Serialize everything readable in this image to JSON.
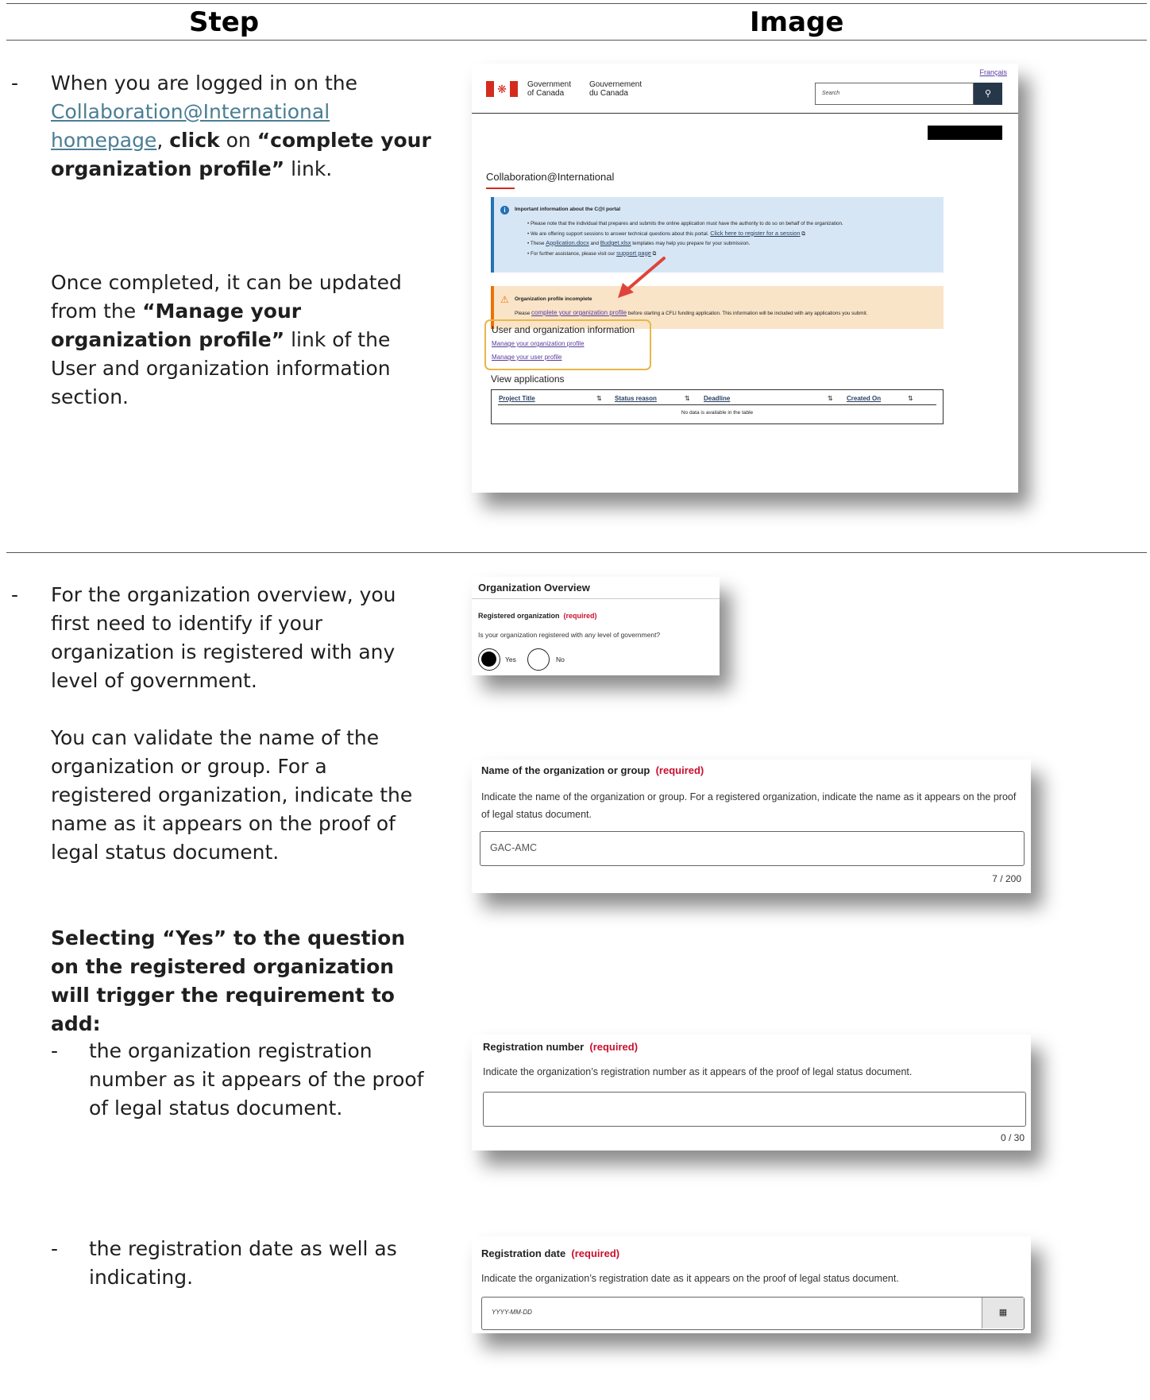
{
  "header": {
    "step": "Step",
    "image": "Image"
  },
  "section1": {
    "p1_a": "When you are logged in on the ",
    "p1_link": "Collaboration@International homepage",
    "p1_b": ", ",
    "p1_click": "click",
    "p1_c": " on ",
    "p1_bold": "“complete your organization profile”",
    "p1_d": " link.",
    "p2_a": "Once completed, it can be updated from the ",
    "p2_bold": "“Manage your organization profile”",
    "p2_b": " link of the User and organization information section."
  },
  "portal": {
    "lang_link": "Français",
    "gov_en_1": "Government",
    "gov_en_2": "of Canada",
    "gov_fr_1": "Gouvernement",
    "gov_fr_2": "du Canada",
    "search_placeholder": "Search",
    "site_title": "Collaboration@International",
    "info_title": "Important information about the C@I portal",
    "info_b1": "Please note that the individual that prepares and submits the online application must have the authority to do so on behalf of the organization.",
    "info_b2_a": "We are offering support sessions to answer technical questions about this portal. ",
    "info_b2_link": "Click here to register for a session",
    "info_b3_a": "These ",
    "info_b3_link1": "Application.docx",
    "info_b3_b": " and ",
    "info_b3_link2": "Budget.xlsx",
    "info_b3_c": " templates may help you prepare for your submission.",
    "info_b4_a": "For further assistance, please visit our ",
    "info_b4_link": "support page",
    "warn_title": "Organization profile incomplete",
    "warn_a": "Please ",
    "warn_link": "complete your organization profile",
    "warn_b": " before starting a CFLI funding application. This information will be included with any applications you submit.",
    "user_section_title": "User and organization information",
    "manage_org": "Manage your organization profile",
    "manage_user": "Manage your user profile",
    "view_apps": "View applications",
    "col_project": "Project Title",
    "col_status": "Status reason",
    "col_deadline": "Deadline",
    "col_created": "Created On",
    "no_data": "No data is available in the table"
  },
  "section2": {
    "p1": "For the organization overview, you first need to identify if your organization is registered with any level of government.",
    "p2": "You can validate the name of the organization or group. For a registered organization, indicate the name as it appears on the proof of legal status document.",
    "p3": "Selecting “Yes” to the question on the registered organization will trigger the requirement to add:",
    "b1": "the organization registration number as it appears of the proof of legal status document.",
    "b2": "the registration date as well as indicating."
  },
  "overview": {
    "title": "Organization Overview",
    "field_label": "Registered organization",
    "required": "(required)",
    "question": "Is your organization registered with any level of government?",
    "yes": "Yes",
    "no": "No",
    "selected": "Yes"
  },
  "org_name": {
    "label": "Name of the organization or group",
    "required": "(required)",
    "hint": "Indicate the name of the organization or group. For a registered organization, indicate the name as it appears on the proof of legal status document.",
    "value": "GAC-AMC",
    "counter": "7 / 200"
  },
  "reg_number": {
    "label": "Registration number",
    "required": "(required)",
    "hint": "Indicate the organization’s registration number as it appears of the proof of legal status document.",
    "value": "",
    "counter": "0 / 30"
  },
  "reg_date": {
    "label": "Registration date",
    "required": "(required)",
    "hint": "Indicate the organization’s registration date as it appears on the proof of legal status document.",
    "placeholder": "YYYY-MM-DD"
  },
  "colors": {
    "flag_red": "#d52b1e",
    "info_bg": "#d7e6f5",
    "warn_bg": "#f9e4c8",
    "highlight": "#e8b64a",
    "link": "#4a7e94",
    "required": "#c8102e"
  }
}
